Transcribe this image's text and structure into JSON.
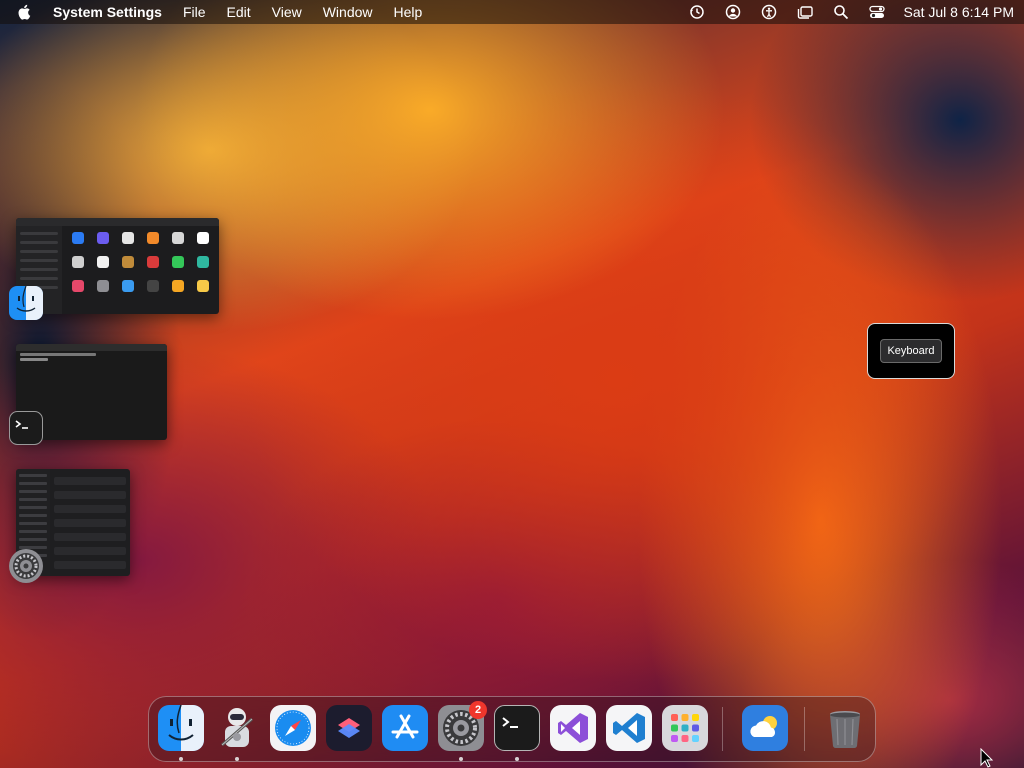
{
  "menubar": {
    "app_name": "System Settings",
    "menus": [
      "File",
      "Edit",
      "View",
      "Window",
      "Help"
    ],
    "status_icons": [
      "time-machine-icon",
      "user-account-icon",
      "accessibility-icon",
      "stage-manager-icon",
      "spotlight-search-icon",
      "control-center-icon"
    ],
    "clock": "Sat Jul 8  6:14 PM"
  },
  "stage_manager": {
    "groups": [
      {
        "app": "Finder",
        "icon": "finder-icon"
      },
      {
        "app": "Terminal",
        "icon": "terminal-icon"
      },
      {
        "app": "System Settings",
        "icon": "system-settings-icon"
      }
    ]
  },
  "tooltip": {
    "label": "Keyboard"
  },
  "dock": {
    "items": [
      {
        "name": "Finder",
        "icon": "finder-icon",
        "running": true
      },
      {
        "name": "Automator",
        "icon": "automator-icon",
        "running": true
      },
      {
        "name": "Safari",
        "icon": "safari-icon",
        "running": false
      },
      {
        "name": "Shortcuts",
        "icon": "shortcuts-icon",
        "running": false
      },
      {
        "name": "App Store",
        "icon": "app-store-icon",
        "running": false
      },
      {
        "name": "System Settings",
        "icon": "system-settings-icon",
        "running": true,
        "badge": "2"
      },
      {
        "name": "Terminal",
        "icon": "terminal-icon",
        "running": true
      },
      {
        "name": "Visual Studio",
        "icon": "visual-studio-icon",
        "running": false
      },
      {
        "name": "Visual Studio Code",
        "icon": "vscode-icon",
        "running": false
      },
      {
        "name": "Launchpad",
        "icon": "launchpad-icon",
        "running": false
      },
      {
        "name": "Weather",
        "icon": "weather-icon",
        "running": false
      },
      {
        "name": "Trash",
        "icon": "trash-icon",
        "running": false
      }
    ]
  }
}
